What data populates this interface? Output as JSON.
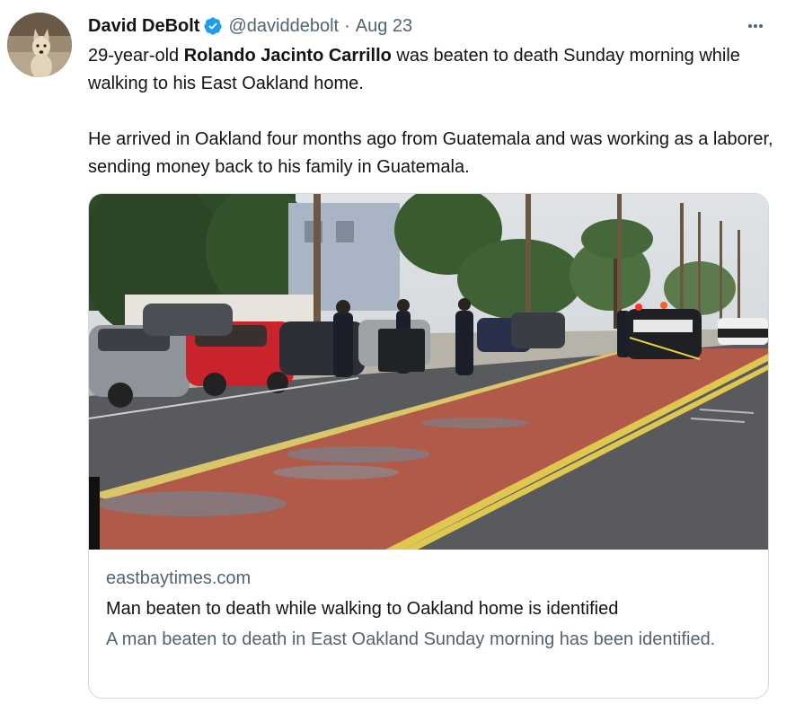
{
  "tweet": {
    "author_name": "David DeBolt",
    "handle": "@daviddebolt",
    "separator": "·",
    "date": "Aug 23",
    "avatar_icon": "dog-photo-avatar",
    "verified_icon": "verified-badge-icon",
    "verified_color": "#1d9bf0",
    "more_icon": "more-options-icon",
    "text": {
      "p1_prefix": "29-year-old ",
      "p1_bold": "Rolando Jacinto Carrillo",
      "p1_suffix": " was beaten to death Sunday morning while walking to his East Oakland home.",
      "p2": "He arrived in Oakland four months ago from Guatemala and was working as a laborer, sending money back to his family in Guatemala."
    }
  },
  "link_card": {
    "image_alt_icon": "street-crime-scene-photo",
    "domain": "eastbaytimes.com",
    "title": "Man beaten to death while walking to Oakland home is identified",
    "description": "A man beaten to death in East Oakland Sunday morning has been identified."
  },
  "colors": {
    "text_primary": "#0f1419",
    "text_secondary": "#536471",
    "border": "#cfd9de"
  }
}
